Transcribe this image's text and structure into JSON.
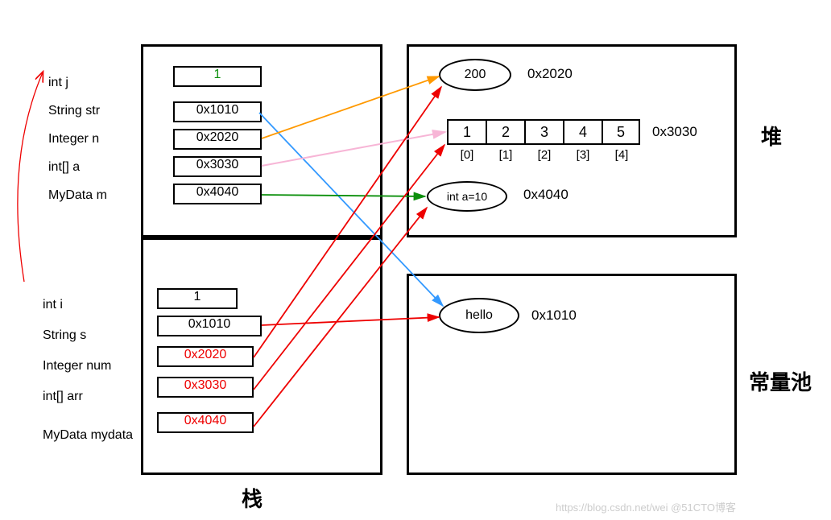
{
  "stack": {
    "label": "栈",
    "upper": {
      "vars": [
        "int j",
        "String str",
        "Integer n",
        "int[] a",
        "MyData m"
      ],
      "values": [
        "1",
        "0x1010",
        "0x2020",
        "0x3030",
        "0x4040"
      ]
    },
    "lower": {
      "vars": [
        "int i",
        "String s",
        "Integer num",
        "int[] arr",
        "MyData mydata"
      ],
      "values": [
        "1",
        "0x1010",
        "0x2020",
        "0x3030",
        "0x4040"
      ]
    }
  },
  "heap": {
    "label": "堆",
    "obj200": {
      "value": "200",
      "addr": "0x2020"
    },
    "array": {
      "values": [
        "1",
        "2",
        "3",
        "4",
        "5"
      ],
      "indices": [
        "[0]",
        "[1]",
        "[2]",
        "[3]",
        "[4]"
      ],
      "addr": "0x3030"
    },
    "mydata": {
      "value": "int a=10",
      "addr": "0x4040"
    }
  },
  "constpool": {
    "label": "常量池",
    "hello": {
      "value": "hello",
      "addr": "0x1010"
    }
  },
  "watermark": "https://blog.csdn.net/wei @51CTO博客"
}
